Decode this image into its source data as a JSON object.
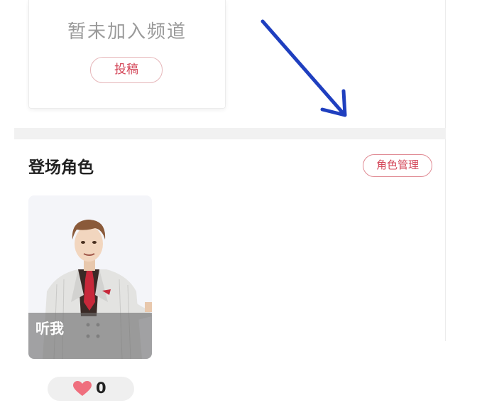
{
  "channel": {
    "empty_text": "暂未加入频道",
    "submit_label": "投稿"
  },
  "characters_section": {
    "title": "登场角色",
    "manage_label": "角色管理",
    "cards": [
      {
        "name": "听我",
        "likes": "0"
      }
    ]
  },
  "colors": {
    "accent": "#d4485a",
    "arrow": "#1f3fbf",
    "heart": "#ef6f7e"
  },
  "icons": {
    "like": "heart-icon",
    "annotation": "arrow-annotation"
  }
}
